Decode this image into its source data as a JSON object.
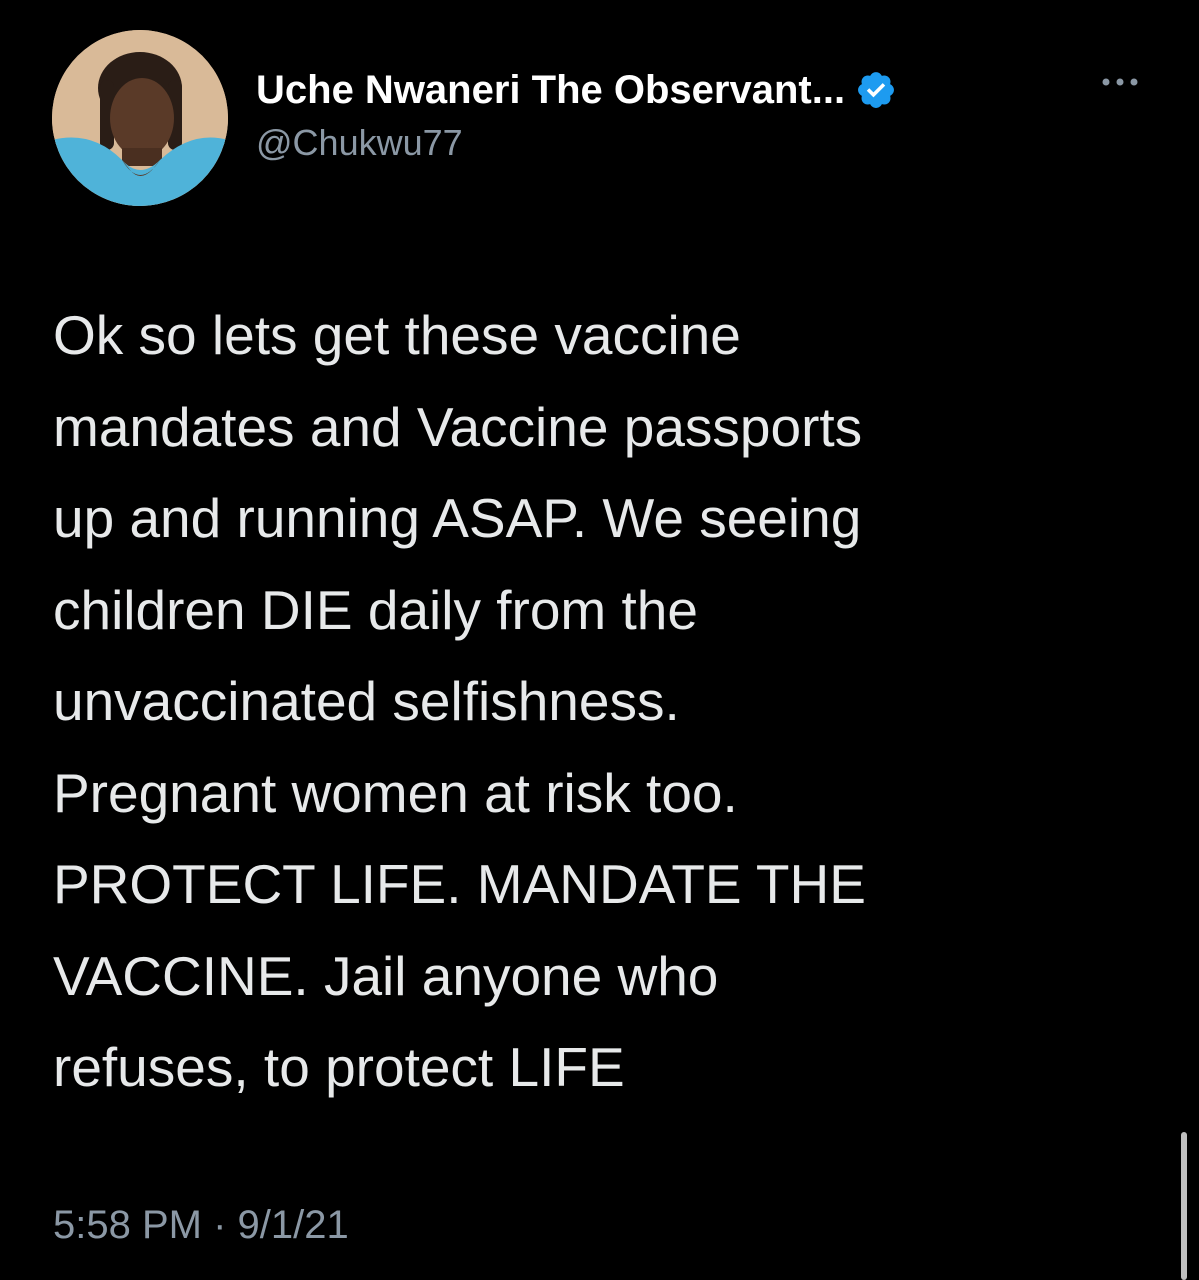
{
  "tweet": {
    "author": {
      "display_name": "Uche Nwaneri The Observant...",
      "handle": "@Chukwu77",
      "verified": true
    },
    "text": "Ok so lets get these vaccine\nmandates and Vaccine passports\nup and running ASAP. We seeing\nchildren DIE daily from the\nunvaccinated selfishness.\nPregnant women at risk too.\nPROTECT LIFE. MANDATE THE\nVACCINE. Jail anyone who\nrefuses, to protect LIFE",
    "timestamp": "5:58 PM · 9/1/21"
  },
  "icons": {
    "verified": "verified-badge-icon",
    "more": "more-options-icon"
  },
  "colors": {
    "background": "#000000",
    "text_primary": "#e7e9ea",
    "text_secondary": "#8b98a5",
    "verified_blue": "#1d9bf0",
    "avatar_shirt": "#4fb3d9"
  }
}
